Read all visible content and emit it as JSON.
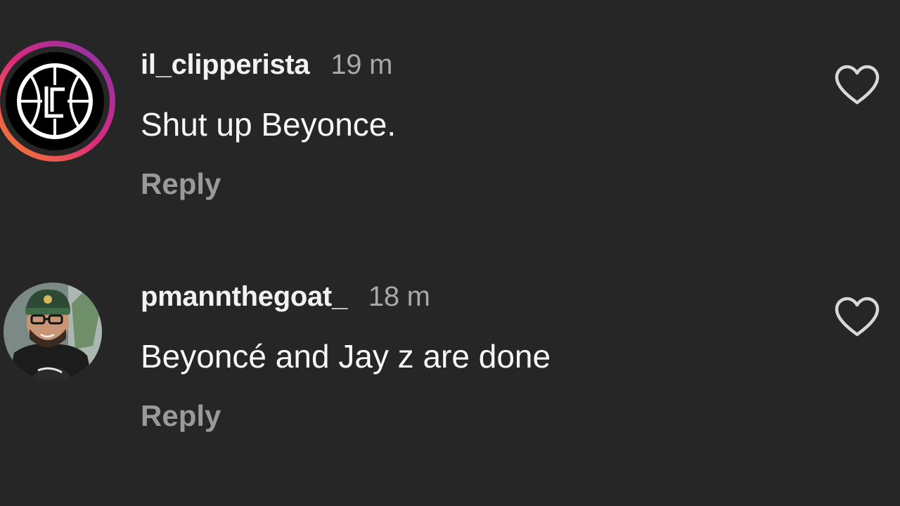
{
  "comments": [
    {
      "username": "il_clipperista",
      "time": "19 m",
      "text": "Shut up Beyonce.",
      "reply_label": "Reply",
      "avatar_icon": "clippers-logo-icon",
      "has_story_ring": true,
      "like_icon": "heart-outline-icon"
    },
    {
      "username": "pmannthegoat_",
      "time": "18 m",
      "text": "Beyoncé and Jay z are done",
      "reply_label": "Reply",
      "avatar_icon": "person-photo-avatar",
      "has_story_ring": false,
      "like_icon": "heart-outline-icon"
    }
  ],
  "colors": {
    "background": "#262626",
    "username": "#f2f2f2",
    "timestamp": "#a8a8a8",
    "reply": "#9a9a9a",
    "story_ring_start": "#f58529",
    "story_ring_mid": "#dd2a7b",
    "story_ring_end": "#8134af"
  }
}
